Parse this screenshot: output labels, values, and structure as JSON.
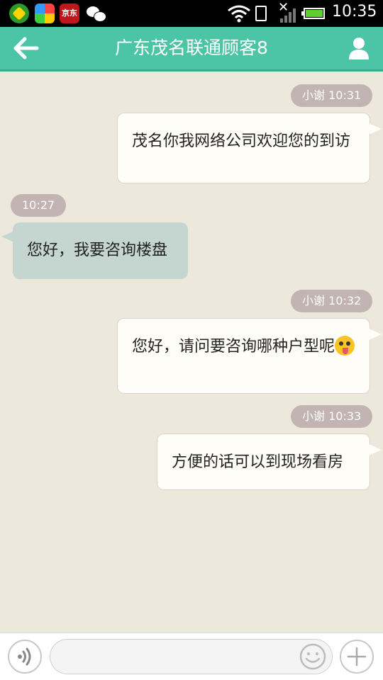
{
  "status_bar": {
    "time": "10:35",
    "app_icons": [
      "360-icon",
      "app-store-icon",
      "jd-icon",
      "wechat-icon"
    ],
    "jd_label": "京东"
  },
  "header": {
    "title": "广东茂名联通顾客8"
  },
  "messages": [
    {
      "direction": "out",
      "timestamp": "小谢 10:31",
      "text": "茂名你我网络公司欢迎您的到访"
    },
    {
      "direction": "in",
      "timestamp": "10:27",
      "text": "您好，我要咨询楼盘"
    },
    {
      "direction": "out",
      "timestamp": "小谢 10:32",
      "text": "您好，请问要咨询哪种户型呢",
      "emoji": "tongue-wink-emoji"
    },
    {
      "direction": "out",
      "timestamp": "小谢 10:33",
      "text": "方便的话可以到现场看房"
    }
  ],
  "input": {
    "value": "",
    "placeholder": ""
  },
  "colors": {
    "header": "#4cc5a7",
    "chat_bg": "#ede8dc",
    "incoming_bubble": "#c5d6d1",
    "outgoing_bubble": "#fffdf8",
    "timestamp_pill": "#c2b4b3"
  }
}
